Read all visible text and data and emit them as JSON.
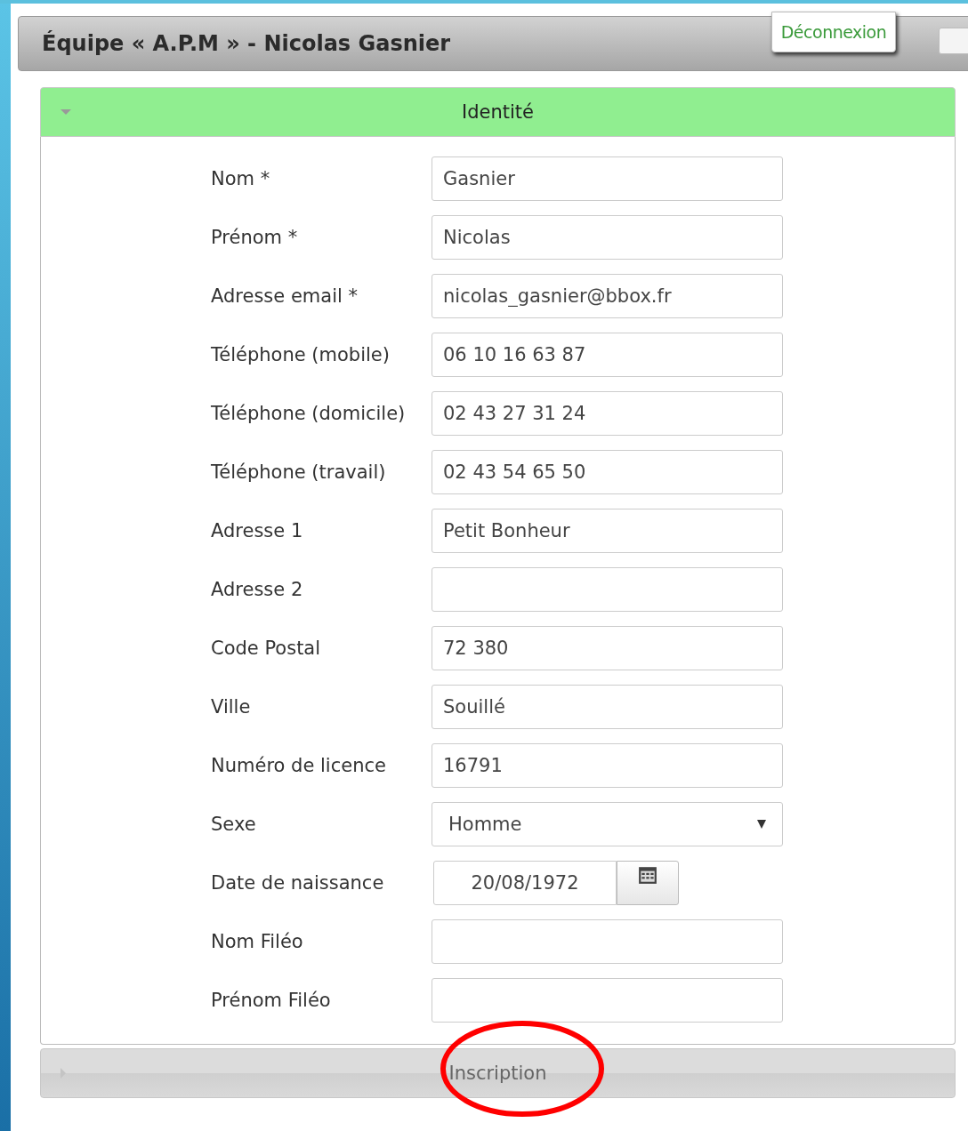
{
  "header": {
    "title": "Équipe « A.P.M » - Nicolas Gasnier",
    "logout_button": "Déconnexion"
  },
  "sections": [
    {
      "title": "Identité",
      "expanded": true,
      "fields": [
        {
          "label": "Nom *",
          "kind": "text",
          "value": "Gasnier"
        },
        {
          "label": "Prénom *",
          "kind": "text",
          "value": "Nicolas"
        },
        {
          "label": "Adresse email *",
          "kind": "text",
          "value": "nicolas_gasnier@bbox.fr"
        },
        {
          "label": "Téléphone (mobile)",
          "kind": "text",
          "value": "06 10 16 63 87"
        },
        {
          "label": "Téléphone (domicile)",
          "kind": "text",
          "value": "02 43 27 31 24"
        },
        {
          "label": "Téléphone (travail)",
          "kind": "text",
          "value": "02 43 54 65 50"
        },
        {
          "label": "Adresse 1",
          "kind": "text",
          "value": "Petit Bonheur"
        },
        {
          "label": "Adresse 2",
          "kind": "text"
        },
        {
          "label": "Code Postal",
          "kind": "text",
          "value": "72 380"
        },
        {
          "label": "Ville",
          "kind": "text",
          "value": "Souillé"
        },
        {
          "label": "Numéro de licence",
          "kind": "text",
          "value": "16791"
        },
        {
          "label": "Sexe",
          "kind": "select",
          "value": "Homme"
        },
        {
          "label": "Date de naissance",
          "kind": "date",
          "value": "20/08/1972"
        },
        {
          "label": "Nom Filéo",
          "kind": "text"
        },
        {
          "label": "Prénom Filéo",
          "kind": "text"
        }
      ]
    },
    {
      "title": "Inscription",
      "expanded": false,
      "circled": true
    }
  ]
}
